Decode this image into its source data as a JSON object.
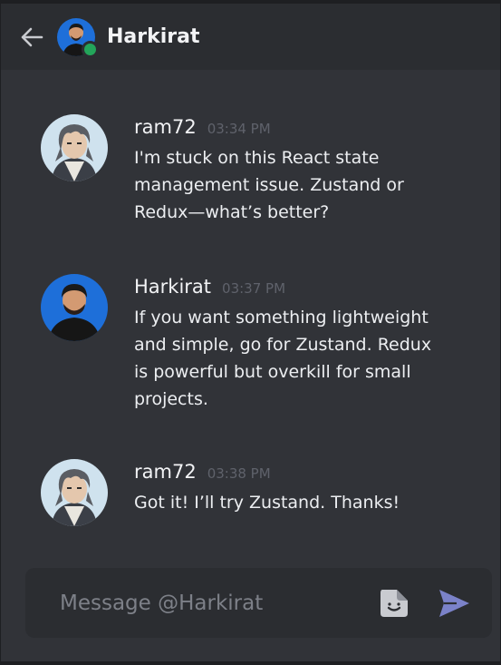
{
  "header": {
    "back_icon": "arrow-left-icon",
    "title": "Harkirat",
    "status": "online",
    "status_color": "#23a55a"
  },
  "messages": [
    {
      "author": "ram72",
      "time": "03:34 PM",
      "text": "I'm stuck on this React state management issue. Zustand or Redux—what’s better?"
    },
    {
      "author": "Harkirat",
      "time": "03:37 PM",
      "text": "If you want something lightweight and simple, go for Zustand. Redux is powerful but overkill for small projects."
    },
    {
      "author": "ram72",
      "time": "03:38 PM",
      "text": "Got it! I’ll try Zustand. Thanks!"
    }
  ],
  "composer": {
    "placeholder": "Message @Harkirat",
    "value": "",
    "sticker_icon": "sticker-icon",
    "send_icon": "send-icon",
    "accent": "#7b82c9"
  }
}
